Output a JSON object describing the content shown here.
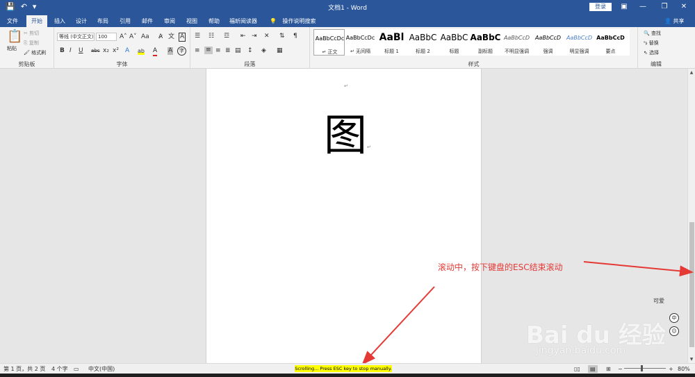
{
  "titlebar": {
    "title": "文档1 - Word",
    "login": "登录",
    "qat": {
      "save_icon": "💾",
      "undo_icon": "↶",
      "redo_icon": "▾",
      "customize_icon": "⚲"
    },
    "ribbon_display": "▣",
    "minimize": "—",
    "restore": "❐",
    "close": "✕"
  },
  "tabs": [
    "文件",
    "开始",
    "插入",
    "设计",
    "布局",
    "引用",
    "邮件",
    "审阅",
    "视图",
    "帮助",
    "福昕阅读器"
  ],
  "active_tab": "开始",
  "tellme": "操作说明搜索",
  "share": "共享",
  "ribbon": {
    "clipboard": {
      "label": "剪贴板",
      "paste": "粘贴",
      "cut": "剪切",
      "copy": "复制",
      "format_painter": "格式刷"
    },
    "font": {
      "label": "字体",
      "font_name": "等线 (中文正文)",
      "font_size": "100",
      "grow": "A˄",
      "shrink": "A˅",
      "case": "Aa",
      "clear": "A̷",
      "phonetic": "文",
      "border": "A",
      "bold": "B",
      "italic": "I",
      "underline": "U",
      "strike": "abc",
      "subscript": "x₂",
      "superscript": "x²",
      "effects": "A",
      "highlight": "ab",
      "color": "A",
      "shade": "A",
      "circle": "字"
    },
    "paragraph": {
      "label": "段落"
    },
    "styles": {
      "label": "样式",
      "items": [
        {
          "sample": "AaBbCcDc",
          "name": "↵ 正文"
        },
        {
          "sample": "AaBbCcDc",
          "name": "↵ 无间隔"
        },
        {
          "sample": "AaBl",
          "name": "标题 1"
        },
        {
          "sample": "AaBbC",
          "name": "标题 2"
        },
        {
          "sample": "AaBbC",
          "name": "标题"
        },
        {
          "sample": "AaBbC",
          "name": "副标题"
        },
        {
          "sample": "AaBbCcD",
          "name": "不明显强调"
        },
        {
          "sample": "AaBbCcD",
          "name": "强调"
        },
        {
          "sample": "AaBbCcD",
          "name": "明显强调"
        },
        {
          "sample": "AaBbCcD",
          "name": "要点"
        }
      ]
    },
    "editing": {
      "label": "编辑",
      "find": "查找",
      "replace": "替换",
      "select": "选择"
    }
  },
  "document": {
    "para_mark": "↵",
    "big_char": "图"
  },
  "annotation": {
    "text": "滚动中，按下键盘的ESC结束滚动",
    "color": "#e53935"
  },
  "watermark": {
    "logo": "Bai du 经验",
    "url": "jingyan.baidu.com",
    "cute": "可爱",
    "zh": "中",
    "emoji": "☺"
  },
  "statusbar": {
    "page": "第 1 页，共 2 页",
    "words": "4 个字",
    "language": "中文(中国)",
    "scroll_message": "Scrolling...  Press ESC key to stop manually.",
    "zoom": "80%",
    "zoom_minus": "−",
    "zoom_plus": "+"
  },
  "scrollbar": {
    "up": "▲",
    "down": "▼"
  }
}
